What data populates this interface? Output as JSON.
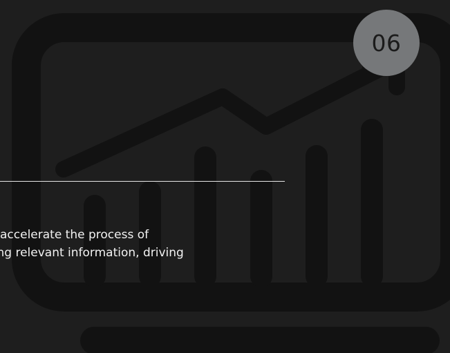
{
  "badge": {
    "number": "06"
  },
  "description": {
    "line_1": "accelerate the process of",
    "line_2": "ning relevant information, driving"
  },
  "colors": {
    "background": "#1e1e1e",
    "icon_stroke": "#121212",
    "badge_fill": "#76787a",
    "divider": "#e8e8e8",
    "text": "#f2f2f2"
  },
  "icons": {
    "background_art": "monitor-growth-chart-icon"
  }
}
